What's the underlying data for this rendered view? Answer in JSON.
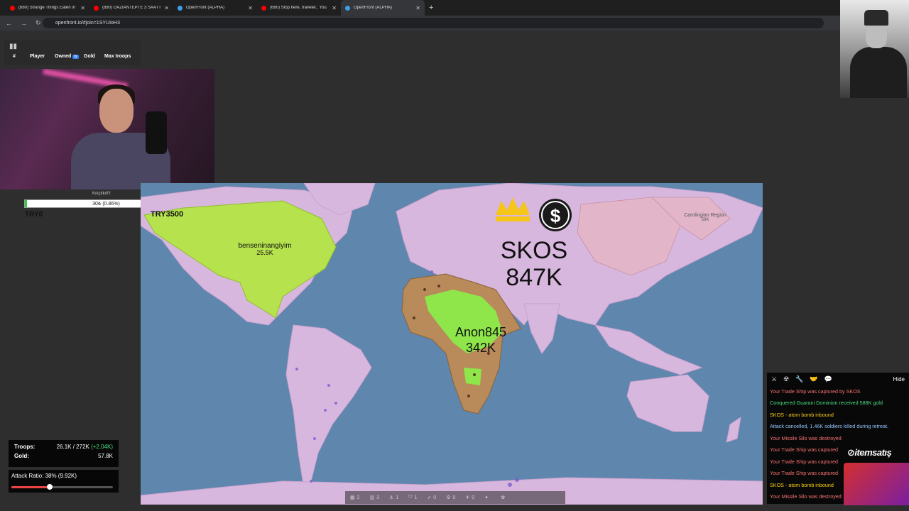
{
  "browser": {
    "tabs": [
      {
        "title": "(680) Strange Things Eaten in t",
        "color": "#ff0000",
        "active": false
      },
      {
        "title": "(680) GAZİANTEPTE 3 SAATTE",
        "color": "#ff0000",
        "active": false
      },
      {
        "title": "OpenFront (ALPHA)",
        "color": "#3aa0e8",
        "active": false
      },
      {
        "title": "(680) Stop here, traveler.. You",
        "color": "#ff0000",
        "active": false
      },
      {
        "title": "OpenFront (ALPHA)",
        "color": "#3aa0e8",
        "active": true
      }
    ],
    "url": "openfront.io/#join=1SYUIoH3"
  },
  "leaderboard": {
    "headers": [
      "#",
      "Player",
      "Owned",
      "Gold",
      "Max troops"
    ],
    "owned_badge": "⇅"
  },
  "player_tag": {
    "name": "Kılıçlıkıl!!!",
    "bar_text": "30₺ (0.86%)",
    "bar_percent": 0.86,
    "bar_color": "#2ecc40",
    "left_label": "TRY0"
  },
  "map": {
    "overlay_label": "TRY3500",
    "region_label": "Carolingian Region",
    "region_sub": "56K",
    "players": [
      {
        "name": "benseninangiyim",
        "troops": "25.5K"
      },
      {
        "name": "SKOS",
        "troops": "847K"
      },
      {
        "name": "Anon845",
        "troops": "342K"
      }
    ],
    "colors": {
      "ocean": "#5f86ad",
      "lilac": "#d8b7de",
      "green": "#b5e24d",
      "bright": "#8ee64a",
      "brown": "#b98a5a"
    }
  },
  "stats": {
    "troops_label": "Troops:",
    "troops_value": "26.1K / 272K",
    "troops_gain": "(+2.04K)",
    "gold_label": "Gold:",
    "gold_value": "57.8K",
    "attack_label": "Attack Ratio: 38% (9.92K)",
    "attack_ratio": 0.38
  },
  "toolbar": {
    "items": [
      {
        "icon": "city-icon",
        "glyph": "▦",
        "count": "2"
      },
      {
        "icon": "factory-icon",
        "glyph": "▥",
        "count": "3"
      },
      {
        "icon": "port-icon",
        "glyph": "⚓",
        "count": "1"
      },
      {
        "icon": "defense-icon",
        "glyph": "⛉",
        "count": "1"
      },
      {
        "icon": "missile-icon",
        "glyph": "➶",
        "count": "0"
      },
      {
        "icon": "silo-icon",
        "glyph": "⚙",
        "count": "0"
      },
      {
        "icon": "sam-icon",
        "glyph": "✈",
        "count": "0"
      },
      {
        "icon": "warship-icon",
        "glyph": "✦",
        "count": ""
      },
      {
        "icon": "nuke-icon",
        "glyph": "☢",
        "count": ""
      }
    ]
  },
  "events": {
    "hide_label": "Hide",
    "filter_icons": [
      "sword-icon",
      "radiation-icon",
      "wrench-icon",
      "handshake-icon",
      "chat-icon"
    ],
    "filter_glyphs": [
      "⚔",
      "☢",
      "🔧",
      "🤝",
      "💬"
    ],
    "items": [
      {
        "text": "Your Trade Ship was captured by SKOS",
        "color": "#f87171"
      },
      {
        "text": "Conquered Guarani Dominion received 588K gold",
        "color": "#4ade80"
      },
      {
        "text": "SKOS - atom bomb inbound",
        "color": "#facc15"
      },
      {
        "text": "Attack cancelled, 1.46K soldiers killed during retreat.",
        "color": "#93c5fd"
      },
      {
        "text": "Your Missile Silo was destroyed",
        "color": "#f87171"
      },
      {
        "text": "Your Trade Ship was captured",
        "color": "#f87171"
      },
      {
        "text": "Your Trade Ship was captured",
        "color": "#f87171"
      },
      {
        "text": "Your Trade Ship was captured",
        "color": "#f87171"
      },
      {
        "text": "SKOS - atom bomb inbound",
        "color": "#facc15"
      },
      {
        "text": "Your Missile Silo was destroyed",
        "color": "#f87171"
      }
    ]
  },
  "watermark": "⊘itemsatış"
}
